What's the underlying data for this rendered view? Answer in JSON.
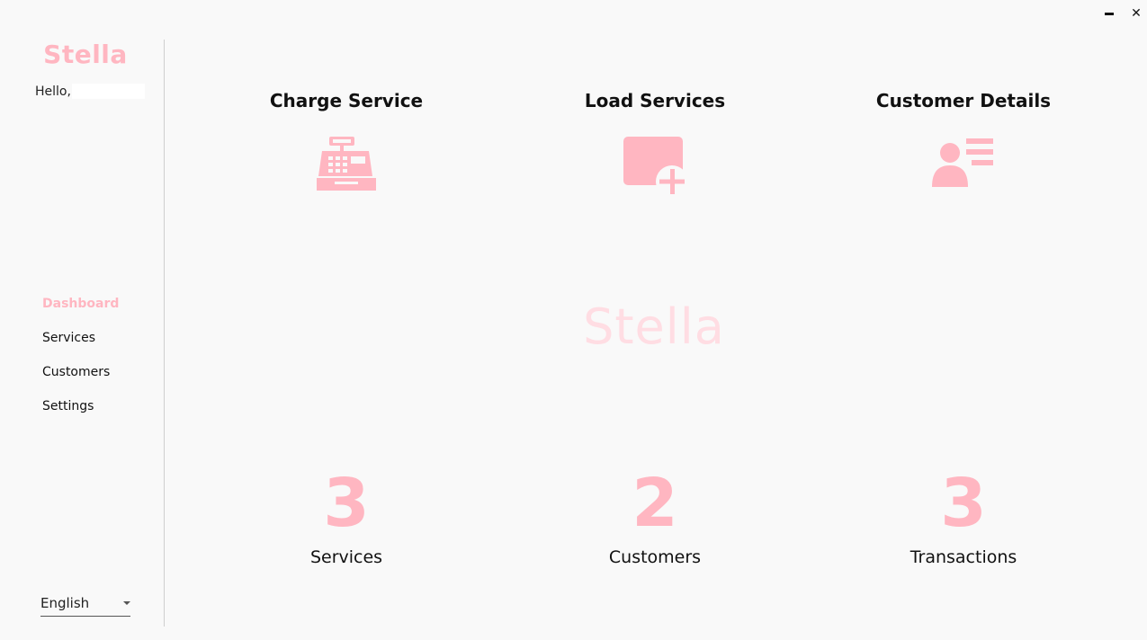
{
  "window": {
    "minimize_icon": "minimize-icon",
    "close_label": "✕"
  },
  "sidebar": {
    "brand": "Stella",
    "greeting": "Hello,",
    "nav": [
      {
        "label": "Dashboard",
        "active": true
      },
      {
        "label": "Services",
        "active": false
      },
      {
        "label": "Customers",
        "active": false
      },
      {
        "label": "Settings",
        "active": false
      }
    ],
    "language": "English"
  },
  "actions": [
    {
      "label": "Charge Service",
      "icon": "cash-register-icon"
    },
    {
      "label": "Load Services",
      "icon": "add-card-icon"
    },
    {
      "label": "Customer Details",
      "icon": "contact-card-icon"
    }
  ],
  "watermark": "Stella",
  "stats": [
    {
      "value": "3",
      "label": "Services"
    },
    {
      "value": "2",
      "label": "Customers"
    },
    {
      "value": "3",
      "label": "Transactions"
    }
  ],
  "colors": {
    "accent": "#ffb6c1",
    "watermark": "#ffdde3",
    "background": "#f9f9f9"
  }
}
